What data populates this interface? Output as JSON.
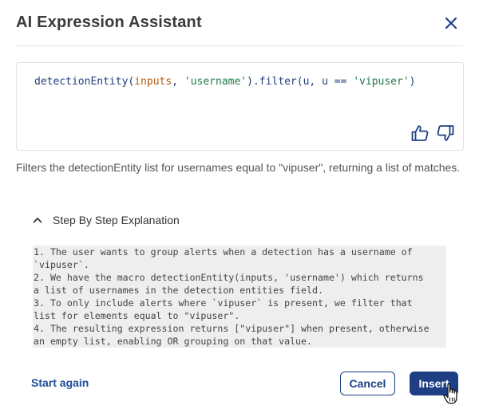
{
  "dialog": {
    "title": "AI Expression Assistant",
    "close_icon": "close-icon"
  },
  "code": {
    "fn": "detectionEntity",
    "open": "(",
    "arg1": "inputs",
    "sep1": ", ",
    "arg2": "'username'",
    "close": ").filter(",
    "param": "u, u == ",
    "arg3": "'vipuser'",
    "end": ")"
  },
  "feedback": {
    "like_icon": "thumbs-up-icon",
    "dislike_icon": "thumbs-down-icon"
  },
  "description": "Filters the detectionEntity list for usernames equal to \"vipuser\", returning a list of matches.",
  "explanation": {
    "toggle_label": "Step By Step Explanation",
    "toggle_icon": "chevron-up-icon",
    "lines": [
      "1. The user wants to group alerts when a detection has a username of",
      "`vipuser`.",
      "2. We have the macro detectionEntity(inputs, 'username') which returns",
      "a list of usernames in the detection entities field.",
      "3. To only include alerts where `vipuser` is present, we filter that",
      "list for elements equal to \"vipuser\".",
      "4. The resulting expression returns [\"vipuser\"] when present, otherwise",
      "an empty list, enabling OR grouping on that value."
    ]
  },
  "footer": {
    "start_again": "Start again",
    "cancel": "Cancel",
    "insert": "Insert"
  },
  "colors": {
    "primary": "#1e3f84",
    "code_function": "#1f3f7a",
    "code_variable": "#b8560b",
    "code_string": "#1e7a4a"
  }
}
